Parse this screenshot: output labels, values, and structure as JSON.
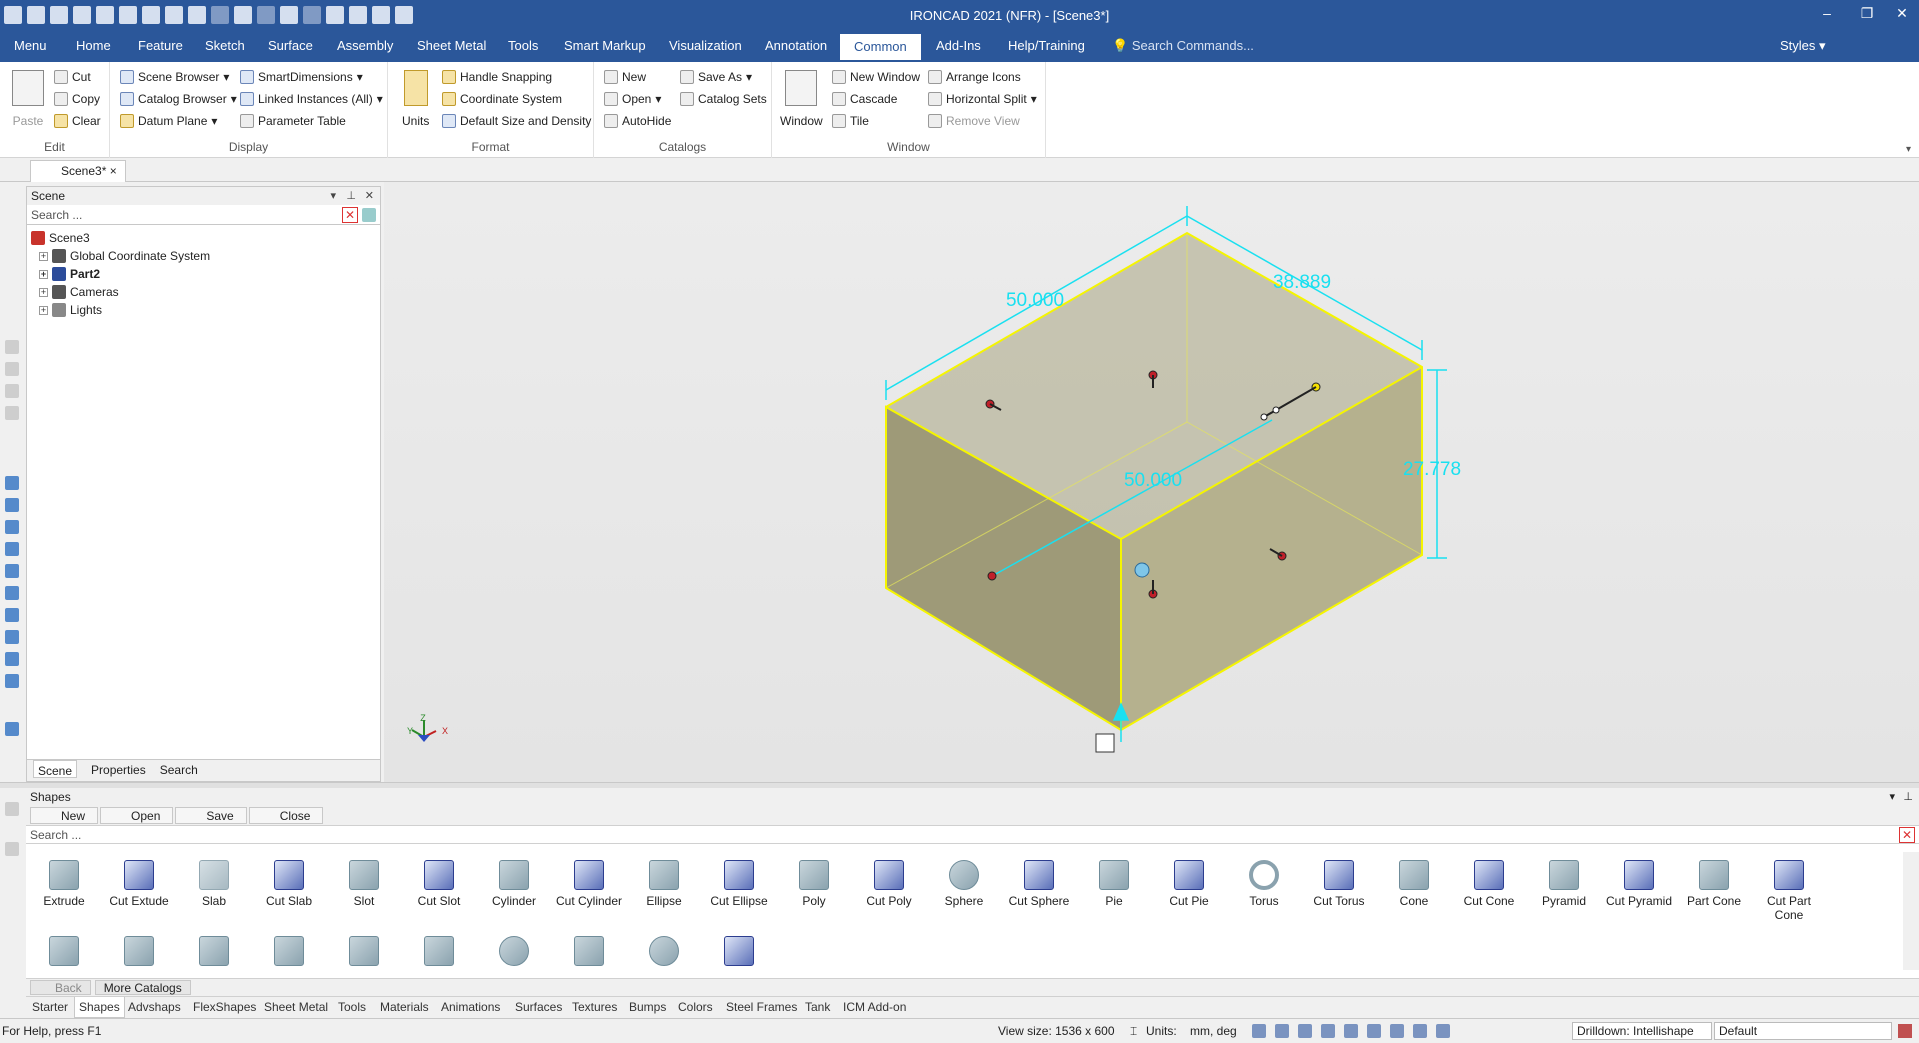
{
  "window": {
    "title": "IRONCAD 2021 (NFR) - [Scene3*]",
    "min": "–",
    "restore": "❐",
    "close": "✕"
  },
  "menu": {
    "tabs": [
      "Menu",
      "Home",
      "Feature",
      "Sketch",
      "Surface",
      "Assembly",
      "Sheet Metal",
      "Tools",
      "Smart Markup",
      "Visualization",
      "Annotation",
      "Common",
      "Add-Ins",
      "Help/Training"
    ],
    "active": "Common",
    "search_placeholder": "Search Commands...",
    "styles": "Styles"
  },
  "ribbon": {
    "edit": {
      "label": "Edit",
      "paste": "Paste",
      "cut": "Cut",
      "copy": "Copy",
      "clear": "Clear"
    },
    "display": {
      "label": "Display",
      "scene_browser": "Scene Browser",
      "catalog_browser": "Catalog Browser",
      "datum_plane": "Datum Plane",
      "smart_dimensions": "SmartDimensions",
      "linked_instances": "Linked Instances (All)",
      "parameter_table": "Parameter Table"
    },
    "format": {
      "label": "Format",
      "units": "Units",
      "handle_snapping": "Handle Snapping",
      "coordinate_system": "Coordinate System",
      "default_size": "Default Size and Density"
    },
    "catalogs": {
      "label": "Catalogs",
      "new": "New",
      "open": "Open",
      "autohide": "AutoHide",
      "save_as": "Save As",
      "catalog_sets": "Catalog Sets"
    },
    "window": {
      "label": "Window",
      "window": "Window",
      "new_window": "New Window",
      "cascade": "Cascade",
      "tile": "Tile",
      "arrange_icons": "Arrange Icons",
      "horizontal_split": "Horizontal Split",
      "remove_view": "Remove View"
    }
  },
  "doc_tab": "Scene3*",
  "scene_panel": {
    "title": "Scene",
    "search_placeholder": "Search ...",
    "tree": [
      {
        "label": "Scene3",
        "bold": false
      },
      {
        "label": "Global Coordinate System",
        "bold": false
      },
      {
        "label": "Part2",
        "bold": true
      },
      {
        "label": "Cameras",
        "bold": false
      },
      {
        "label": "Lights",
        "bold": false
      }
    ],
    "tabs": [
      "Scene",
      "Properties",
      "Search"
    ]
  },
  "viewport": {
    "dim_width_top": "50.000",
    "dim_depth": "38.889",
    "dim_height": "27.778",
    "dim_width_mid": "50.000",
    "axis_z": "Z",
    "axis_y": "Y",
    "axis_x": "X"
  },
  "shapes_panel": {
    "title": "Shapes",
    "buttons": [
      "New",
      "Open",
      "Save",
      "Close"
    ],
    "search_placeholder": "Search ...",
    "items": [
      "Extrude",
      "Cut Extude",
      "Slab",
      "Cut Slab",
      "Slot",
      "Cut Slot",
      "Cylinder",
      "Cut Cylinder",
      "Ellipse",
      "Cut Ellipse",
      "Poly",
      "Cut Poly",
      "Sphere",
      "Cut Sphere",
      "Pie",
      "Cut Pie",
      "Torus",
      "Cut Torus",
      "Cone",
      "Cut Cone",
      "Pyramid",
      "Cut Pyramid",
      "Part Cone",
      "Cut Part Cone"
    ],
    "back": "Back",
    "more_catalogs": "More Catalogs"
  },
  "catalog_tabs": {
    "items": [
      "Starter",
      "Shapes",
      "Advshaps",
      "FlexShapes",
      "Sheet Metal",
      "Tools",
      "Materials",
      "Animations",
      "Surfaces",
      "Textures",
      "Bumps",
      "Colors",
      "Steel Frames",
      "Tank",
      "ICM Add-on"
    ],
    "active": "Shapes"
  },
  "status": {
    "help": "For Help, press F1",
    "view_size": "View size: 1536 x  600",
    "units_label": "Units:",
    "units_value": "mm, deg",
    "drilldown": "Drilldown: Intellishape",
    "style": "Default"
  },
  "colors": {
    "brand": "#2b579a",
    "dimension": "#19e0f0",
    "edge_highlight": "#f5f500",
    "box_fill": "#b8b38c"
  }
}
